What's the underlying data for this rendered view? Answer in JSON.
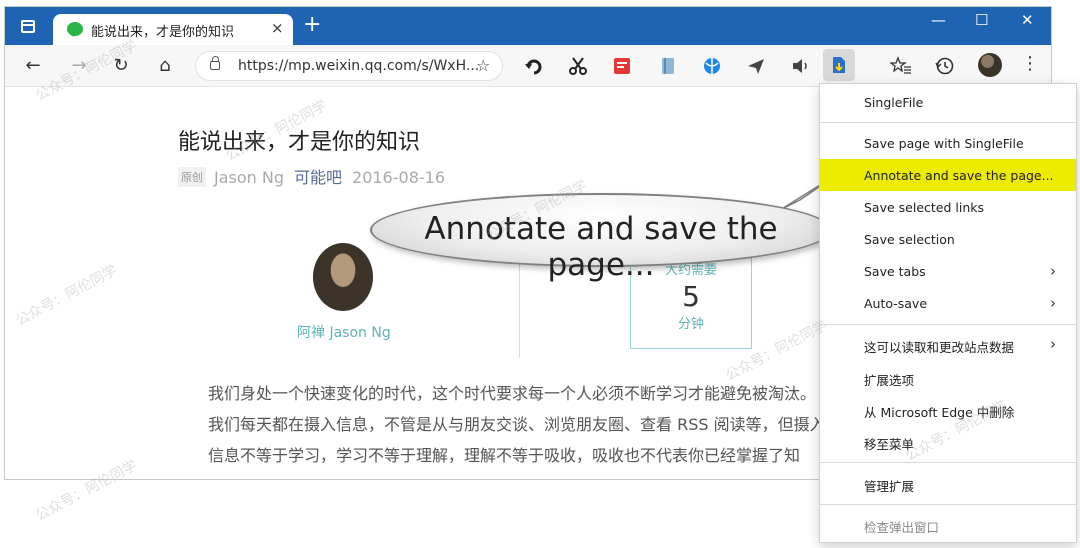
{
  "browser": {
    "tab_title": "能说出来，才是你的知识",
    "tab_close": "×",
    "new_tab": "+",
    "url": "https://mp.weixin.qq.com/s/WxH...",
    "window_controls": {
      "minimize": "—",
      "maximize": "☐",
      "close": "✕"
    }
  },
  "icons": {
    "back": "back-arrow-icon",
    "forward": "forward-arrow-icon",
    "refresh": "refresh-icon",
    "home": "home-icon",
    "lock": "lock-icon",
    "favorite_add": "add-favorite-icon",
    "favorites": "favorites-icon",
    "history": "history-icon",
    "more": "more-dots-icon"
  },
  "article": {
    "title": "能说出来，才是你的知识",
    "badge": "原创",
    "author": "Jason Ng",
    "account": "可能吧",
    "date": "2016-08-16",
    "author_name": "阿禅 Jason Ng",
    "read_label": "大约需要",
    "read_minutes": "5",
    "read_unit": "分钟",
    "body": "我们身处一个快速变化的时代，这个时代要求每一个人必须不断学习才能避免被淘汰。我们每天都在摄入信息，不管是从与朋友交谈、浏览朋友圈、查看 RSS 阅读等，但摄入信息不等于学习，学习不等于理解，理解不等于吸收，吸收也不代表你已经掌握了知识。"
  },
  "callout": {
    "text": "Annotate and save the page..."
  },
  "menu": {
    "items": [
      {
        "label": "SingleFile"
      },
      {
        "label": "Save page with SingleFile"
      },
      {
        "label": "Annotate and save the page..."
      },
      {
        "label": "Save selected links"
      },
      {
        "label": "Save selection"
      },
      {
        "label": "Save tabs"
      },
      {
        "label": "Auto-save"
      },
      {
        "label": "这可以读取和更改站点数据"
      },
      {
        "label": "扩展选项"
      },
      {
        "label": "从 Microsoft Edge 中删除"
      },
      {
        "label": "移至菜单"
      },
      {
        "label": "管理扩展"
      },
      {
        "label": "检查弹出窗口"
      }
    ]
  },
  "colors": {
    "titlebar": "#1f63b3",
    "highlight": "#ecec00",
    "accent": "#5fb3b7"
  },
  "watermark": "公众号：阿伦同学"
}
